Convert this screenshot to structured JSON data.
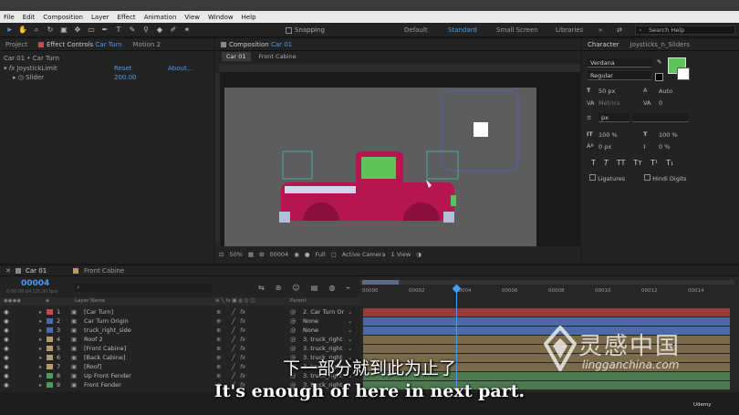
{
  "menu": [
    "File",
    "Edit",
    "Composition",
    "Layer",
    "Effect",
    "Animation",
    "View",
    "Window",
    "Help"
  ],
  "toolbar": {
    "snapping_label": "Snapping",
    "workspaces": [
      {
        "label": "Default",
        "active": false
      },
      {
        "label": "Standard",
        "active": true
      },
      {
        "label": "Small Screen",
        "active": false
      },
      {
        "label": "Libraries",
        "active": false
      }
    ],
    "search_placeholder": "Search Help"
  },
  "left_panel": {
    "tab_project": "Project",
    "tab_effect_controls": "Effect Controls",
    "effect_target": "Car Turn",
    "tab_motion": "Motion 2",
    "breadcrumb": "Car 01 • Car Turn",
    "effect_name": "JoystickLimit",
    "reset_label": "Reset",
    "about_label": "About...",
    "param_label": "Slider",
    "param_value": "200.00"
  },
  "composition": {
    "tab_label": "Composition",
    "comp_name": "Car 01",
    "view_tabs": [
      "Car 01",
      "Front Cabine"
    ],
    "zoom": "50%",
    "timecode": "00004",
    "resolution": "Full",
    "camera": "Active Camera",
    "views": "1 View"
  },
  "character_panel": {
    "tab_character": "Character",
    "tab_other": "Joysticks_n_Sliders",
    "font": "Verdana",
    "style": "Regular",
    "font_size": "50 px",
    "leading": "Auto",
    "tracking": "0",
    "kerning": "Metrics",
    "stroke_unit": "px",
    "vscale": "100 %",
    "hscale": "100 %",
    "baseline": "0 px",
    "tsume": "0 %",
    "ligatures_label": "Ligatures",
    "hindi_label": "Hindi Digits",
    "fill_color": "#5dc35a"
  },
  "timeline": {
    "tab_comp": "Car 01",
    "tab_other": "Front Cabine",
    "timecode": "00004",
    "timecode_sub": "0:00:00:04 (25.00 fps)",
    "col_layer_name": "Layer Name",
    "col_parent": "Parent",
    "ruler_labels": [
      "00000",
      "00002",
      "00004",
      "00006",
      "00008",
      "00010",
      "00012",
      "00014"
    ],
    "layers": [
      {
        "num": "1",
        "name": "[Car Turn]",
        "color": "#c84a4a",
        "parent": "2. Car Turn Or",
        "track": "#9a3a3a"
      },
      {
        "num": "2",
        "name": "Car Turn Origin",
        "color": "#4a6ab3",
        "parent": "None",
        "track": "#4c6aa8"
      },
      {
        "num": "3",
        "name": "truck_right_side",
        "color": "#4a6ab3",
        "parent": "None",
        "track": "#4c6aa8"
      },
      {
        "num": "4",
        "name": "Roof 2",
        "color": "#b79a6b",
        "parent": "3. truck_right",
        "track": "#7a6a4a"
      },
      {
        "num": "5",
        "name": "[Front Cabine]",
        "color": "#b79a6b",
        "parent": "3. truck_right",
        "track": "#7a6a4a"
      },
      {
        "num": "6",
        "name": "[Back Cabine]",
        "color": "#b79a6b",
        "parent": "3. truck_right",
        "track": "#7a6a4a"
      },
      {
        "num": "7",
        "name": "[Roof]",
        "color": "#b79a6b",
        "parent": "3. truck_right",
        "track": "#7a6a4a"
      },
      {
        "num": "8",
        "name": "Up Front Fender",
        "color": "#4d9a5a",
        "parent": "3. truck_right",
        "track": "#4d7a50"
      },
      {
        "num": "9",
        "name": "Front Fender",
        "color": "#4d9a5a",
        "parent": "3. truck_right",
        "track": "#4d7a50"
      }
    ]
  },
  "subtitles": {
    "cn": "下一部分就到此为止了",
    "en": "It's enough of here in next part."
  },
  "watermark": {
    "cn": "灵感中国",
    "en": "lingganchina.com"
  },
  "udemy_label": "Udemy"
}
